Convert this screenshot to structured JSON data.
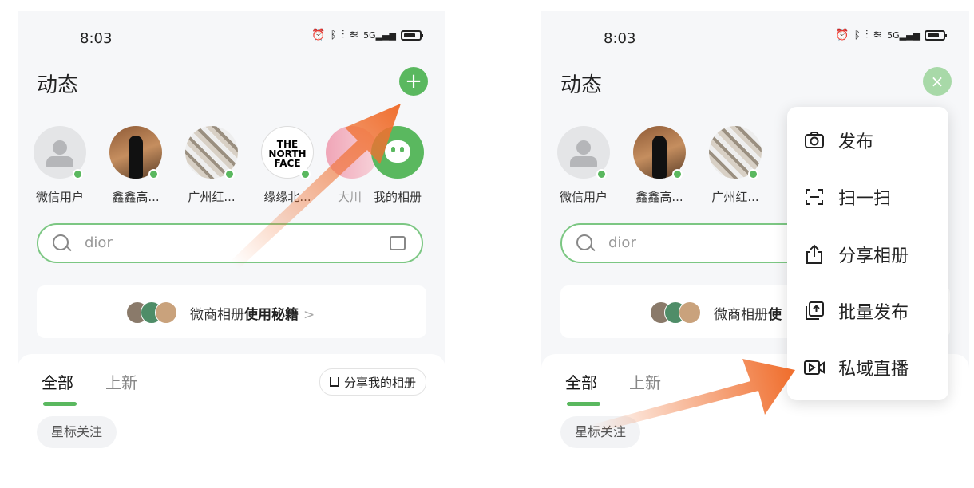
{
  "status": {
    "time": "8:03",
    "signal_label": "5G"
  },
  "header": {
    "title": "动态",
    "add_symbol": "+",
    "close_symbol": "×"
  },
  "avatars": [
    {
      "name": "微信用户"
    },
    {
      "name": "鑫鑫高..."
    },
    {
      "name": "广州红..."
    },
    {
      "name": "缘缘北...",
      "logo_text": "THE NORTH FACE"
    },
    {
      "name": "大川"
    },
    {
      "name": "我的相册"
    }
  ],
  "search": {
    "placeholder": "dior"
  },
  "tips": {
    "prefix": "微商相册",
    "highlight": "使用秘籍",
    "chevron": ">",
    "prefix_cut": "微商相册",
    "highlight_cut": "使"
  },
  "tabs": {
    "all": "全部",
    "new": "上新"
  },
  "share_button": {
    "label": "分享我的相册"
  },
  "chip": {
    "label": "星标关注"
  },
  "menu": {
    "items": [
      {
        "label": "发布",
        "icon": "camera-icon"
      },
      {
        "label": "扫一扫",
        "icon": "scan-icon"
      },
      {
        "label": "分享相册",
        "icon": "share-icon"
      },
      {
        "label": "批量发布",
        "icon": "batch-upload-icon"
      },
      {
        "label": "私域直播",
        "icon": "live-video-icon"
      }
    ]
  },
  "colors": {
    "accent": "#5ab85f",
    "arrow": "#f07030"
  }
}
